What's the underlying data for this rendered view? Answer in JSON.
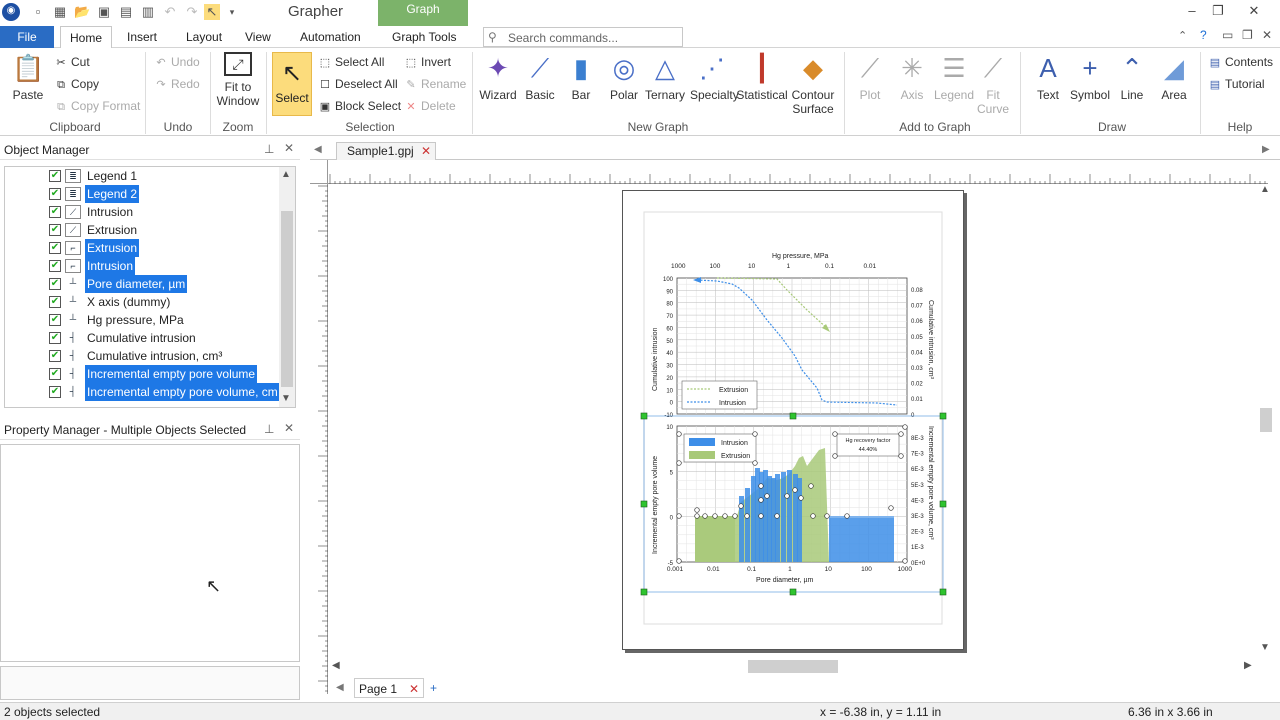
{
  "app": {
    "title": "Grapher",
    "context_tab": "Graph"
  },
  "menu": {
    "file": "File",
    "tabs": [
      "Home",
      "Insert",
      "Layout",
      "View",
      "Automation",
      "Graph Tools"
    ],
    "search_placeholder": "Search commands..."
  },
  "ribbon": {
    "clipboard": {
      "paste": "Paste",
      "cut": "Cut",
      "copy": "Copy",
      "copy_format": "Copy Format",
      "label": "Clipboard"
    },
    "undo": {
      "undo": "Undo",
      "redo": "Redo",
      "label": "Undo"
    },
    "zoom": {
      "fit": "Fit to Window",
      "label": "Zoom"
    },
    "selection": {
      "select": "Select",
      "select_all": "Select All",
      "deselect_all": "Deselect All",
      "block_select": "Block Select",
      "invert": "Invert",
      "rename": "Rename",
      "delete": "Delete",
      "label": "Selection"
    },
    "new_graph": {
      "items": [
        "Wizard",
        "Basic",
        "Bar",
        "Polar",
        "Ternary",
        "Specialty",
        "Statistical",
        "Contour Surface"
      ],
      "label": "New Graph"
    },
    "add_to_graph": {
      "items": [
        "Plot",
        "Axis",
        "Legend",
        "Fit Curve"
      ],
      "label": "Add to Graph"
    },
    "draw": {
      "items": [
        "Text",
        "Symbol",
        "Line",
        "Area"
      ],
      "label": "Draw"
    },
    "help": {
      "contents": "Contents",
      "tutorial": "Tutorial",
      "label": "Help"
    }
  },
  "object_manager": {
    "title": "Object Manager",
    "items": [
      {
        "label": "Legend 1",
        "selected": false
      },
      {
        "label": "Legend 2",
        "selected": true
      },
      {
        "label": "Intrusion",
        "selected": false
      },
      {
        "label": "Extrusion",
        "selected": false
      },
      {
        "label": "Extrusion",
        "selected": true
      },
      {
        "label": "Intrusion",
        "selected": true
      },
      {
        "label": "Pore diameter, µm",
        "selected": true
      },
      {
        "label": "X axis (dummy)",
        "selected": false
      },
      {
        "label": "Hg pressure, MPa",
        "selected": false
      },
      {
        "label": "Cumulative intrusion",
        "selected": false
      },
      {
        "label": "Cumulative intrusion, cm³",
        "selected": false
      },
      {
        "label": "Incremental empty pore volume",
        "selected": true
      },
      {
        "label": "Incremental empty pore volume, cm",
        "selected": true
      }
    ]
  },
  "property_manager": {
    "title": "Property Manager - Multiple Objects Selected"
  },
  "document": {
    "tab": "Sample1.gpj",
    "page_tab": "Page 1"
  },
  "graph": {
    "top": {
      "x_title": "Hg pressure, MPa",
      "x_ticks": [
        "1000",
        "100",
        "10",
        "1",
        "0.1",
        "0.01"
      ],
      "y_title": "Cumulative intrusion",
      "y_ticks": [
        "100",
        "90",
        "80",
        "70",
        "60",
        "50",
        "40",
        "30",
        "20",
        "10",
        "0",
        "-10"
      ],
      "y2_title": "Cumulative intrusion, cm³",
      "y2_ticks": [
        "0.08",
        "0.07",
        "0.06",
        "0.05",
        "0.04",
        "0.03",
        "0.02",
        "0.01",
        "0"
      ],
      "legend": [
        "Extrusion",
        "Intrusion"
      ]
    },
    "bottom": {
      "x_title": "Pore diameter, µm",
      "x_ticks": [
        "0.001",
        "0.01",
        "0.1",
        "1",
        "10",
        "100",
        "1000"
      ],
      "y_title": "Incremental empty pore volume",
      "y_ticks": [
        "10",
        "5",
        "0",
        "-5"
      ],
      "y2_title": "Incremental empty pore volume, cm³",
      "y2_ticks": [
        "8E-3",
        "7E-3",
        "6E-3",
        "5E-3",
        "4E-3",
        "3E-3",
        "2E-3",
        "1E-3",
        "0E+0"
      ],
      "legend": [
        "Intrusion",
        "Extrusion"
      ],
      "note_line1": "Hg recovery factor",
      "note_line2": "44.40%"
    }
  },
  "status": {
    "selected": "2 objects selected",
    "coords": "x = -6.38 in, y = 1.11 in",
    "size": "6.36 in x 3.66 in"
  },
  "colors": {
    "file_blue": "#2a6cc4",
    "context_green": "#7cb36a",
    "select_yellow": "#fcdc7c",
    "highlight": "#1e78e6",
    "intrusion": "#3d8ee8",
    "extrusion": "#a8c979"
  }
}
